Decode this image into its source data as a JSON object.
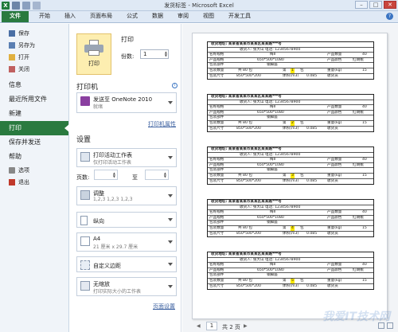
{
  "window": {
    "title": "发货标签 - Microsoft Excel",
    "minimize": "–",
    "restore": "□",
    "close": "✕",
    "help": "?"
  },
  "ribbon": {
    "tabs": [
      "文件",
      "开始",
      "插入",
      "页面布局",
      "公式",
      "数据",
      "审阅",
      "视图",
      "开发工具"
    ]
  },
  "backstage": {
    "save": "保存",
    "save_as": "另存为",
    "open": "打开",
    "close": "关闭",
    "info": "信息",
    "recent": "最近所用文件",
    "new": "新建",
    "print": "打印",
    "save_send": "保存并发送",
    "help": "帮助",
    "options": "选项",
    "exit": "退出"
  },
  "print_panel": {
    "print_button": "打印",
    "heading": "打印",
    "copies_label": "份数:",
    "copies_value": "1",
    "printer_heading": "打印机",
    "printer_name": "发送至 OneNote 2010",
    "printer_status": "就绪",
    "printer_properties": "打印机属性",
    "settings_heading": "设置",
    "what_main": "打印活动工作表",
    "what_sub": "仅打印活动工作表",
    "pages_label": "页数:",
    "pages_to": "至",
    "collate_main": "调整",
    "collate_sub": "1,2,3    1,2,3    1,2,3",
    "orientation": "纵向",
    "paper_main": "A4",
    "paper_sub": "21 厘米 x 29.7 厘米",
    "margins": "自定义边距",
    "scale_main": "无缩放",
    "scale_sub": "打印实际大小的工作表",
    "page_setup": "页面设置"
  },
  "preview": {
    "labels": [
      {
        "addr": "收货地址: 某某省某某市某某区某某路***号",
        "receiver": "收货人: 张大山  电话: 12345678900",
        "product": "名称规格",
        "p_val": "梅II",
        "color_label": "产品数量",
        "color_val": "40",
        "spec_label": "产品规格",
        "spec_val": "650*500*1080",
        "color2": "产品颜色",
        "color2_val": "红胡桃",
        "item_label": "包装部件",
        "item_val": "钢脚座",
        "pkg_label": "包装数量",
        "pkg_total": "共 80 包",
        "seq": "第",
        "seq_no": "1",
        "seq_unit": "包",
        "weight_label": "重量(kg)",
        "weight_val": "15",
        "size_label": "包装尺寸",
        "size_val": "850*500*200",
        "vol_label": "体积(m3)",
        "vol_val": "0.085",
        "loc_label": "收货员"
      },
      {
        "addr": "收货地址: 某某省某某市某某区某某路***号",
        "receiver": "收货人: 张大山  电话: 12345678900",
        "product": "名称规格",
        "p_val": "梅II",
        "color_label": "产品数量",
        "color_val": "40",
        "spec_label": "产品规格",
        "spec_val": "650*500*1080",
        "color2": "产品颜色",
        "color2_val": "红胡桃",
        "item_label": "包装部件",
        "item_val": "钢脚座",
        "pkg_label": "包装数量",
        "pkg_total": "共 80 包",
        "seq": "第",
        "seq_no": "2",
        "seq_unit": "包",
        "weight_label": "重量(kg)",
        "weight_val": "15",
        "size_label": "包装尺寸",
        "size_val": "850*500*200",
        "vol_label": "体积(m3)",
        "vol_val": "0.085",
        "loc_label": "收货员"
      },
      {
        "addr": "收货地址: 某某省某某市某某区某某路***号",
        "receiver": "收货人: 张大山  电话: 12345678900",
        "product": "名称规格",
        "p_val": "梅II",
        "color_label": "产品数量",
        "color_val": "40",
        "spec_label": "产品规格",
        "spec_val": "650*500*1080",
        "color2": "产品颜色",
        "color2_val": "红胡桃",
        "item_label": "包装部件",
        "item_val": "钢脚座",
        "pkg_label": "包装数量",
        "pkg_total": "共 80 包",
        "seq": "第",
        "seq_no": "3",
        "seq_unit": "包",
        "weight_label": "重量(kg)",
        "weight_val": "15",
        "size_label": "包装尺寸",
        "size_val": "850*500*200",
        "vol_label": "体积(m3)",
        "vol_val": "0.085",
        "loc_label": "收货员"
      },
      {
        "addr": "收货地址: 某某省某某市某某区某某路***号",
        "receiver": "收货人: 张大山  电话: 12345678900",
        "product": "名称规格",
        "p_val": "梅II",
        "color_label": "产品数量",
        "color_val": "40",
        "spec_label": "产品规格",
        "spec_val": "650*500*1080",
        "color2": "产品颜色",
        "color2_val": "红胡桃",
        "item_label": "包装部件",
        "item_val": "钢脚座",
        "pkg_label": "包装数量",
        "pkg_total": "共 80 包",
        "seq": "第",
        "seq_no": "4",
        "seq_unit": "包",
        "weight_label": "重量(kg)",
        "weight_val": "15",
        "size_label": "包装尺寸",
        "size_val": "850*500*200",
        "vol_label": "体积(m3)",
        "vol_val": "0.085",
        "loc_label": "收货员"
      },
      {
        "addr": "收货地址: 某某省某某市某某区某某路***号",
        "receiver": "收货人: 张大山  电话: 12345678900",
        "product": "名称规格",
        "p_val": "梅II",
        "color_label": "产品数量",
        "color_val": "40",
        "spec_label": "产品规格",
        "spec_val": "650*500*1080",
        "color2": "产品颜色",
        "color2_val": "红胡桃",
        "item_label": "包装部件",
        "item_val": "钢脚座",
        "pkg_label": "包装数量",
        "pkg_total": "共 80 包",
        "seq": "第",
        "seq_no": "5",
        "seq_unit": "包",
        "weight_label": "重量(kg)",
        "weight_val": "15",
        "size_label": "包装尺寸",
        "size_val": "850*500*200",
        "vol_label": "体积(m3)",
        "vol_val": "0.085",
        "loc_label": "收货员"
      }
    ],
    "current_page": "1",
    "total_pages": "共 2 页",
    "prev_arrow": "◀",
    "next_arrow": "▶",
    "watermark": "我爱IT技术网"
  },
  "colors": {
    "accent_green": "#2a7a3f",
    "print_button_bg": "#fdeeb0",
    "highlight": "#ffea00"
  }
}
